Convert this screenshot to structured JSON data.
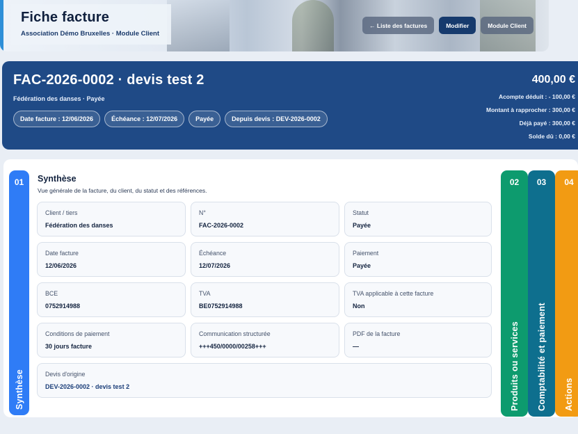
{
  "banner": {
    "title": "Fiche facture",
    "subtitle": "Association Démo Bruxelles · Module Client",
    "buttons": {
      "list_label": "← Liste des factures",
      "edit_label": "Modifier",
      "client_module_label": "Module Client"
    }
  },
  "invoice": {
    "title": "FAC-2026-0002 · devis test 2",
    "meta": "Fédération des danses · Payée",
    "chips": {
      "date": "Date facture : 12/06/2026",
      "due": "Échéance : 12/07/2026",
      "status": "Payée",
      "quote": "Depuis devis : DEV-2026-0002"
    },
    "totals": {
      "amount": "400,00 €",
      "deposit": "Acompte déduit : - 100,00 €",
      "to_reconcile": "Montant à rapprocher : 300,00 €",
      "paid": "Déjà payé : 300,00 €",
      "balance": "Solde dû : 0,00 €"
    }
  },
  "tabs": [
    {
      "num": "01",
      "label": "Synthèse",
      "color": "#2f7cf6"
    },
    {
      "num": "02",
      "label": "Produits ou services",
      "color": "#0d9b6e"
    },
    {
      "num": "03",
      "label": "Comptabilité et paiement",
      "color": "#0e6f8e"
    },
    {
      "num": "04",
      "label": "Actions",
      "color": "#f29b13"
    }
  ],
  "synthese": {
    "title": "Synthèse",
    "description": "Vue générale de la facture, du client, du statut et des références.",
    "fields": {
      "client": {
        "label": "Client / tiers",
        "value": "Fédération des danses"
      },
      "number": {
        "label": "N°",
        "value": "FAC-2026-0002"
      },
      "status": {
        "label": "Statut",
        "value": "Payée"
      },
      "date": {
        "label": "Date facture",
        "value": "12/06/2026"
      },
      "due": {
        "label": "Échéance",
        "value": "12/07/2026"
      },
      "payment": {
        "label": "Paiement",
        "value": "Payée"
      },
      "bce": {
        "label": "BCE",
        "value": "0752914988"
      },
      "tva": {
        "label": "TVA",
        "value": "BE0752914988"
      },
      "tva_applicable": {
        "label": "TVA applicable à cette facture",
        "value": "Non"
      },
      "conditions": {
        "label": "Conditions de paiement",
        "value": "30 jours facture"
      },
      "communication": {
        "label": "Communication structurée",
        "value": "+++450/0000/00258+++"
      },
      "pdf": {
        "label": "PDF de la facture",
        "value": "—"
      },
      "origin_quote": {
        "label": "Devis d'origine",
        "value": "DEV-2026-0002 · devis test 2"
      }
    }
  }
}
